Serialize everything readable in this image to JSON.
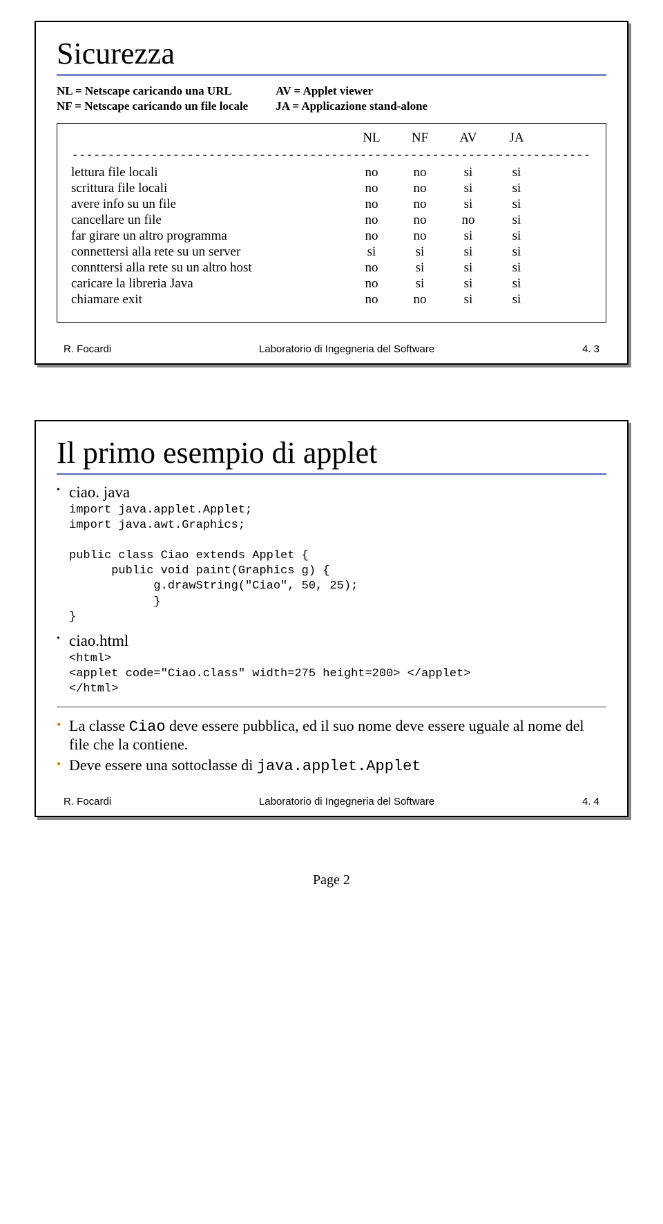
{
  "slide1": {
    "title": "Sicurezza",
    "legend": {
      "left": [
        "NL = Netscape caricando una URL",
        "NF = Netscape caricando un file locale"
      ],
      "right": [
        "AV = Applet viewer",
        "JA =  Applicazione stand-alone"
      ]
    },
    "columns": [
      "NL",
      "NF",
      "AV",
      "JA"
    ],
    "dashes": "---------------------------------------------------------------------------------------------",
    "rows": [
      {
        "label": "lettura file locali",
        "vals": [
          "no",
          "no",
          "si",
          "si"
        ]
      },
      {
        "label": "scrittura file locali",
        "vals": [
          "no",
          "no",
          "si",
          "si"
        ]
      },
      {
        "label": "avere info su un file",
        "vals": [
          "no",
          "no",
          "si",
          "si"
        ]
      },
      {
        "label": "cancellare un file",
        "vals": [
          "no",
          "no",
          "no",
          "si"
        ]
      },
      {
        "label": "far girare un altro programma",
        "vals": [
          "no",
          "no",
          "si",
          "si"
        ]
      },
      {
        "label": "connettersi alla rete su un server",
        "vals": [
          "si",
          "si",
          "si",
          "si"
        ]
      },
      {
        "label": "connttersi alla rete su un altro host",
        "vals": [
          "no",
          "si",
          "si",
          "si"
        ]
      },
      {
        "label": "caricare la libreria Java",
        "vals": [
          "no",
          "si",
          "si",
          "si"
        ]
      },
      {
        "label": "chiamare exit",
        "vals": [
          "no",
          "no",
          "si",
          "si"
        ]
      }
    ],
    "footer": {
      "author": "R. Focardi",
      "course": "Laboratorio di Ingegneria del Software",
      "num": "4. 3"
    }
  },
  "slide2": {
    "title": "Il primo esempio di applet",
    "item1": "ciao. java",
    "code1": "import java.applet.Applet;\nimport java.awt.Graphics;\n\npublic class Ciao extends Applet {\n      public void paint(Graphics g) {\n            g.drawString(\"Ciao\", 50, 25);\n            }\n}",
    "item2": "ciao.html",
    "code2": "<html>\n<applet code=\"Ciao.class\" width=275 height=200> </applet>\n</html>",
    "note1a": "La classe ",
    "note1b": "Ciao",
    "note1c": " deve essere pubblica, ed il suo nome deve essere uguale al nome del file che la contiene.",
    "note2a": "Deve essere una sottoclasse di ",
    "note2b": "java.applet.Applet",
    "footer": {
      "author": "R. Focardi",
      "course": "Laboratorio di Ingegneria del Software",
      "num": "4. 4"
    }
  },
  "pagenum": "Page 2"
}
